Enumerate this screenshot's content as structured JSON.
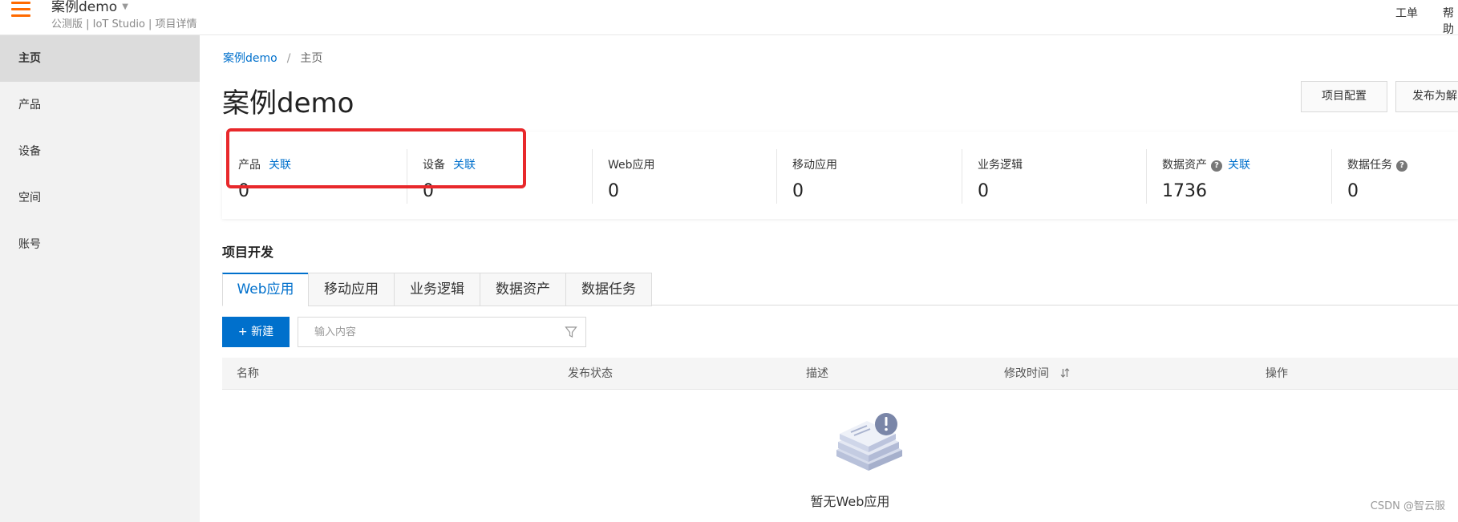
{
  "topbar": {
    "menu_icon": "hamburger-icon",
    "project_name": "案例demo",
    "subtitle": "公测版 | IoT Studio | 项目详情",
    "work_order": "工单",
    "help": "帮助",
    "accent": "#ff6a00"
  },
  "sidebar": {
    "items": [
      {
        "label": "主页"
      },
      {
        "label": "产品"
      },
      {
        "label": "设备"
      },
      {
        "label": "空间"
      },
      {
        "label": "账号"
      }
    ]
  },
  "breadcrumb": {
    "root": "案例demo",
    "separator": "/",
    "current": "主页"
  },
  "page": {
    "title": "案例demo",
    "config_button": "项目配置",
    "publish_button": "发布为解"
  },
  "stats": [
    {
      "label": "产品",
      "link": "关联",
      "value": "0"
    },
    {
      "label": "设备",
      "link": "关联",
      "value": "0"
    },
    {
      "label": "Web应用",
      "value": "0"
    },
    {
      "label": "移动应用",
      "value": "0"
    },
    {
      "label": "业务逻辑",
      "value": "0"
    },
    {
      "label": "数据资产",
      "help": "?",
      "link": "关联",
      "value": "1736"
    },
    {
      "label": "数据任务",
      "help": "?",
      "value": "0"
    }
  ],
  "highlight_color": "#e8282b",
  "dev": {
    "section_title": "项目开发",
    "tabs": [
      {
        "label": "Web应用"
      },
      {
        "label": "移动应用"
      },
      {
        "label": "业务逻辑"
      },
      {
        "label": "数据资产"
      },
      {
        "label": "数据任务"
      }
    ],
    "new_button": "+ 新建",
    "search_placeholder": "输入内容",
    "columns": [
      "名称",
      "发布状态",
      "描述",
      "修改时间",
      "操作"
    ],
    "empty_text": "暂无Web应用"
  },
  "colors": {
    "primary": "#0070cc",
    "sidebar_bg": "#f2f2f2"
  },
  "watermark": "CSDN @智云服"
}
